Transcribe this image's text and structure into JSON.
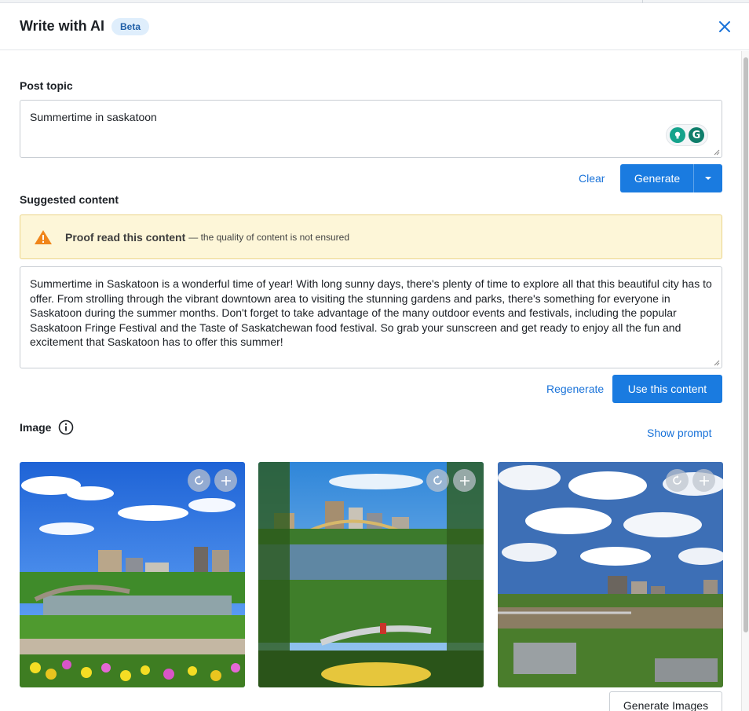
{
  "dialog": {
    "title": "Write with AI",
    "badge": "Beta"
  },
  "post_topic": {
    "label": "Post topic",
    "value": "Summertime in saskatoon",
    "clear_label": "Clear",
    "generate_label": "Generate"
  },
  "suggested": {
    "label": "Suggested content",
    "warning_strong": "Proof read this content",
    "warning_rest": "— the quality of content is not ensured",
    "content": "Summertime in Saskatoon is a wonderful time of year! With long sunny days, there's plenty of time to explore all that this beautiful city has to offer. From strolling through the vibrant downtown area to visiting the stunning gardens and parks, there's something for everyone in Saskatoon during the summer months. Don't forget to take advantage of the many outdoor events and festivals, including the popular Saskatoon Fringe Festival and the Taste of Saskatchewan food festival. So grab your sunscreen and get ready to enjoy all the fun and excitement that Saskatoon has to offer this summer!",
    "regenerate_label": "Regenerate",
    "use_label": "Use this content"
  },
  "image": {
    "label": "Image",
    "show_prompt_label": "Show prompt",
    "generate_images_label": "Generate Images"
  },
  "colors": {
    "primary": "#1a7be0",
    "link": "#1a73d9",
    "warning_bg": "#fdf6d8",
    "warning_icon": "#f0851a",
    "badge_bg": "#dfeefc"
  },
  "icons": [
    "close-icon",
    "grammarly-icon",
    "chevron-down-icon",
    "warning-icon",
    "info-icon",
    "regenerate-icon",
    "plus-icon"
  ]
}
